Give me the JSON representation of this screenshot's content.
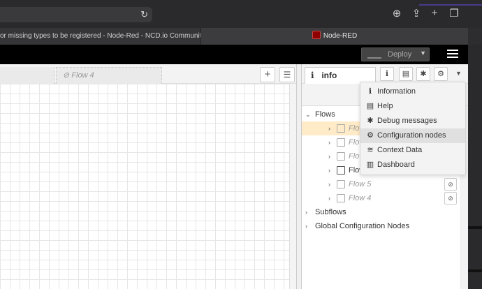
{
  "browser": {
    "tab_left_title": "or missing types to be registered - Node-Red - NCD.io Community",
    "tab_active_title": "Node-RED"
  },
  "header": {
    "deploy_label": "Deploy"
  },
  "workspace": {
    "tabs": [
      {
        "label": "Flow 4",
        "disabled": true
      }
    ]
  },
  "sidebar": {
    "active_tab": "info",
    "tree": {
      "flows_label": "Flows",
      "flows": [
        {
          "label": "Flow",
          "disabled": true,
          "selected": true
        },
        {
          "label": "Flow",
          "disabled": true
        },
        {
          "label": "Flow",
          "disabled": true
        },
        {
          "label": "Flow",
          "disabled": false
        },
        {
          "label": "Flow 5",
          "disabled": true
        },
        {
          "label": "Flow 4",
          "disabled": true
        }
      ],
      "subflows_label": "Subflows",
      "global_config_label": "Global Configuration Nodes"
    }
  },
  "menu": {
    "items": [
      {
        "label": "Information",
        "icon": "info-icon"
      },
      {
        "label": "Help",
        "icon": "book-icon"
      },
      {
        "label": "Debug messages",
        "icon": "bug-icon"
      },
      {
        "label": "Configuration nodes",
        "icon": "gear-icon",
        "highlighted": true
      },
      {
        "label": "Context Data",
        "icon": "database-icon"
      },
      {
        "label": "Dashboard",
        "icon": "bar-chart-icon"
      }
    ]
  },
  "colors": {
    "selected_row": "#ffebc7",
    "header_bg": "#000000"
  }
}
